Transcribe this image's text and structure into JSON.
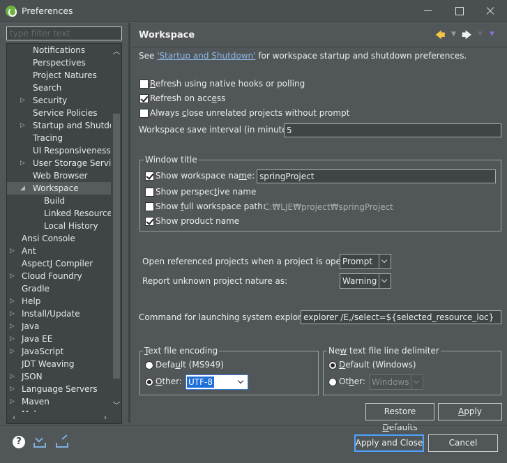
{
  "window": {
    "title": "Preferences"
  },
  "filter": {
    "placeholder": "type filter text"
  },
  "tree": {
    "items": [
      {
        "label": "Notifications",
        "level": 2,
        "expander": ""
      },
      {
        "label": "Perspectives",
        "level": 2,
        "expander": ""
      },
      {
        "label": "Project Natures",
        "level": 2,
        "expander": ""
      },
      {
        "label": "Search",
        "level": 2,
        "expander": ""
      },
      {
        "label": "Security",
        "level": 2,
        "expander": "▷"
      },
      {
        "label": "Service Policies",
        "level": 2,
        "expander": ""
      },
      {
        "label": "Startup and Shutdown",
        "level": 2,
        "expander": "▷"
      },
      {
        "label": "Tracing",
        "level": 2,
        "expander": ""
      },
      {
        "label": "UI Responsiveness Monitoring",
        "level": 2,
        "expander": ""
      },
      {
        "label": "User Storage Service",
        "level": 2,
        "expander": "▷"
      },
      {
        "label": "Web Browser",
        "level": 2,
        "expander": ""
      },
      {
        "label": "Workspace",
        "level": 2,
        "expander": "◢",
        "selected": true
      },
      {
        "label": "Build",
        "level": 3,
        "expander": ""
      },
      {
        "label": "Linked Resources",
        "level": 3,
        "expander": ""
      },
      {
        "label": "Local History",
        "level": 3,
        "expander": ""
      },
      {
        "label": "Ansi Console",
        "level": 1,
        "expander": ""
      },
      {
        "label": "Ant",
        "level": 1,
        "expander": "▷"
      },
      {
        "label": "AspectJ Compiler",
        "level": 1,
        "expander": ""
      },
      {
        "label": "Cloud Foundry",
        "level": 1,
        "expander": "▷"
      },
      {
        "label": "Gradle",
        "level": 1,
        "expander": ""
      },
      {
        "label": "Help",
        "level": 1,
        "expander": "▷"
      },
      {
        "label": "Install/Update",
        "level": 1,
        "expander": "▷"
      },
      {
        "label": "Java",
        "level": 1,
        "expander": "▷"
      },
      {
        "label": "Java EE",
        "level": 1,
        "expander": "▷"
      },
      {
        "label": "JavaScript",
        "level": 1,
        "expander": "▷"
      },
      {
        "label": "JDT Weaving",
        "level": 1,
        "expander": ""
      },
      {
        "label": "JSON",
        "level": 1,
        "expander": "▷"
      },
      {
        "label": "Language Servers",
        "level": 1,
        "expander": "▷"
      },
      {
        "label": "Maven",
        "level": 1,
        "expander": "▷"
      },
      {
        "label": "Mylyn",
        "level": 1,
        "expander": "▷"
      }
    ]
  },
  "page": {
    "title": "Workspace",
    "intro_before": "See ",
    "intro_link": "'Startup and Shutdown'",
    "intro_after": " for workspace startup and shutdown preferences.",
    "refresh_native_pre": "",
    "refresh_native_ul": "R",
    "refresh_native_post": "efresh using native hooks or polling",
    "refresh_native_checked": false,
    "refresh_access_pre": "Refresh on acc",
    "refresh_access_ul": "e",
    "refresh_access_post": "ss",
    "refresh_access_checked": true,
    "close_unrelated_pre": "Always ",
    "close_unrelated_ul": "c",
    "close_unrelated_post": "lose unrelated projects without prompt",
    "close_unrelated_checked": false,
    "save_interval_label": "Workspace save interval (in minutes):",
    "save_interval_value": "5",
    "window_title_group": "Window title",
    "show_ws_name_pre": "Show workspace na",
    "show_ws_name_ul": "m",
    "show_ws_name_post": "e:",
    "show_ws_name_checked": true,
    "ws_name_value": "springProject",
    "show_perspective_pre": "Show perspec",
    "show_perspective_ul": "t",
    "show_perspective_post": "ive name",
    "show_perspective_checked": false,
    "show_full_path_pre": "Show ",
    "show_full_path_ul": "f",
    "show_full_path_post": "ull workspace path:",
    "show_full_path_checked": false,
    "full_path_value": "C:₩LJE₩project₩springProject",
    "show_product_label": "Show product name",
    "show_product_checked": true,
    "open_ref_label": "Open referenced projects when a project is opened:",
    "open_ref_value": "Prompt",
    "report_nature_label": "Report unknown project nature as:",
    "report_nature_value": "Warning",
    "command_label": "Command for launching system explorer:",
    "command_value": "explorer /E,/select=${selected_resource_loc}",
    "encoding_group": "Text file encoding",
    "encoding_group_ul": "T",
    "encoding_group_post": "ext file encoding",
    "enc_default_pre": "Defa",
    "enc_default_ul": "u",
    "enc_default_post": "lt (MS949)",
    "enc_default_selected": false,
    "enc_other_pre": "",
    "enc_other_ul": "O",
    "enc_other_post": "ther:",
    "enc_other_selected": true,
    "enc_other_value": "UTF-8",
    "delim_group": "New text file line delimiter",
    "delim_group_pre": "Ne",
    "delim_group_ul": "w",
    "delim_group_post": " text file line delimiter",
    "delim_default_pre": "",
    "delim_default_ul": "D",
    "delim_default_post": "efault (Windows)",
    "delim_default_selected": true,
    "delim_other_pre": "Ot",
    "delim_other_ul": "h",
    "delim_other_post": "er:",
    "delim_other_selected": false,
    "delim_other_value": "Windows",
    "restore_pre": "Restore ",
    "restore_ul": "D",
    "restore_post": "efaults",
    "apply_ul": "A",
    "apply_post": "pply"
  },
  "footer": {
    "apply_close_label": "Apply and Close",
    "cancel_label": "Cancel",
    "help_glyph": "?"
  },
  "icons": {
    "app": "spring-icon",
    "help": "help-icon",
    "import": "import-icon",
    "export": "export-icon",
    "back": "back-arrow-icon",
    "forward": "forward-arrow-icon",
    "menu": "view-menu-icon"
  },
  "colors": {
    "background": "#515658",
    "tree_background": "#3f4446",
    "link": "#8fb8e8",
    "selection": "#1e6fd9",
    "default_button_border": "#4da3ff"
  }
}
